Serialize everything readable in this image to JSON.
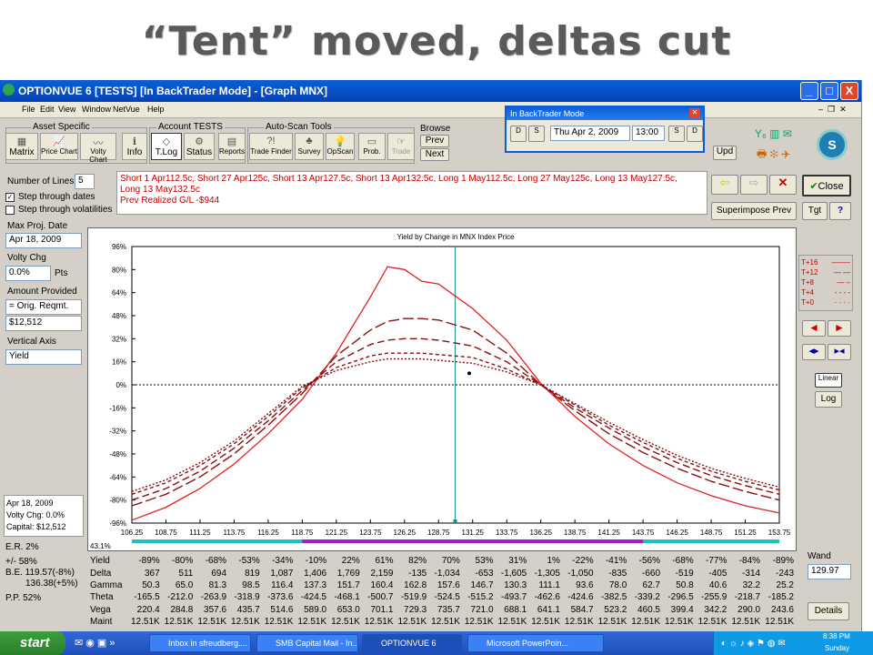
{
  "slide": {
    "title": "“Tent” moved, deltas cut"
  },
  "window": {
    "title": "OPTIONVUE 6   [TESTS]   [In BackTrader Mode] - [Graph MNX]",
    "min": "_",
    "max": "□",
    "close": "X"
  },
  "menu": [
    "File",
    "Edit",
    "View",
    "Window",
    "NetVue",
    "Help"
  ],
  "toolbar": {
    "group_asset": "Asset Specific",
    "group_account": "Account TESTS",
    "group_autoscan": "Auto-Scan Tools",
    "browse": "Browse",
    "matrix": "Matrix",
    "price_chart": "Price Chart",
    "volty_chart": "Volty Chart",
    "info": "Info",
    "tlog": "T.Log",
    "status": "Status",
    "reports": "Reports",
    "trade_finder": "Trade Finder",
    "survey": "Survey",
    "opscan": "OpScan",
    "prob": "Prob.",
    "trade": "Trade",
    "prev": "Prev",
    "next": "Next",
    "upd": "Upd"
  },
  "backtrader": {
    "title": "In BackTrader Mode",
    "date": "Thu Apr 2, 2009",
    "time": "13:00",
    "btn_d_back": "D",
    "btn_s_back": "S",
    "btn_s_fwd": "S",
    "btn_d_fwd": "D"
  },
  "left_panel": {
    "num_lines_label": "Number of Lines",
    "num_lines_value": "5",
    "step_dates": "Step through dates",
    "step_volts": "Step through volatilities",
    "max_proj_label": "Max Proj. Date",
    "max_proj_value": "Apr 18, 2009",
    "volty_chg_label": "Volty Chg",
    "volty_chg_value": "0.0%",
    "volty_unit": "Pts",
    "amount_label": "Amount Provided",
    "amount_select": "= Orig. Reqmt.",
    "amount_value": "$12,512",
    "vert_axis_label": "Vertical Axis",
    "vert_axis_value": "Yield",
    "summary_date": "Apr 18, 2009",
    "summary_volty": "Volty Chg:  0.0%",
    "summary_capital": "Capital:  $12,512",
    "er": "E.R.    2%",
    "pm": "+/-    58%",
    "be1": "B.E.  119.57(-8%)",
    "be2": "136.38(+5%)",
    "pp": "P.P.  52%"
  },
  "strategy": {
    "line1": "Short 1 Apr112.5c, Short 27 Apr125c, Short 13 Apr127.5c, Short 13 Apr132.5c, Long 1 May112.5c, Long 27 May125c, Long 13 May127.5c,",
    "line2": "Long 13 May132.5c",
    "line3": "Prev Realized G/L -$944"
  },
  "right_panel": {
    "close": "Close",
    "superimpose": "Superimpose Prev",
    "tgt": "Tgt",
    "help": "?",
    "linear": "Linear",
    "log": "Log",
    "wand": "Wand",
    "wand_value": "129.97",
    "details": "Details"
  },
  "legend": [
    "T+16",
    "T+12",
    "T+8",
    "T+4",
    "T+0"
  ],
  "chart_data": {
    "type": "line",
    "title": "Yield by Change in MNX Index Price",
    "xlabel": "",
    "ylabel": "",
    "x_ticks": [
      "106.25",
      "108.75",
      "111.25",
      "113.75",
      "116.25",
      "118.75",
      "121.25",
      "123.75",
      "126.25",
      "128.75",
      "131.25",
      "133.75",
      "136.25",
      "138.75",
      "141.25",
      "143.75",
      "146.25",
      "148.75",
      "151.25",
      "153.75"
    ],
    "y_ticks": [
      "96%",
      "80%",
      "64%",
      "48%",
      "32%",
      "16%",
      "0%",
      "-16%",
      "-32%",
      "-48%",
      "-64%",
      "-80%",
      "-96%"
    ],
    "ylim": [
      -96,
      96
    ],
    "xlim": [
      106.25,
      153.75
    ],
    "corner_label": "43.1%",
    "current_price": 129.97,
    "x": [
      106.25,
      108.75,
      111.25,
      113.75,
      116.25,
      118.75,
      121.25,
      123.75,
      125.0,
      126.25,
      127.5,
      128.75,
      131.25,
      133.75,
      136.25,
      138.75,
      141.25,
      143.75,
      146.25,
      148.75,
      151.25,
      153.75
    ],
    "series": [
      {
        "name": "T+16",
        "values": [
          -94,
          -85,
          -72,
          -55,
          -34,
          -10,
          22,
          61,
          82,
          80,
          72,
          70,
          53,
          31,
          1,
          -22,
          -41,
          -56,
          -68,
          -77,
          -84,
          -89
        ]
      },
      {
        "name": "T+12",
        "values": [
          -84,
          -76,
          -64,
          -48,
          -28,
          -6,
          20,
          38,
          44,
          46,
          46,
          45,
          38,
          22,
          0,
          -18,
          -34,
          -47,
          -58,
          -67,
          -74,
          -80
        ]
      },
      {
        "name": "T+8",
        "values": [
          -80,
          -72,
          -60,
          -44,
          -25,
          -4,
          16,
          28,
          31,
          32,
          32,
          31,
          27,
          16,
          0,
          -16,
          -30,
          -43,
          -54,
          -63,
          -70,
          -76
        ]
      },
      {
        "name": "T+4",
        "values": [
          -76,
          -68,
          -56,
          -41,
          -22,
          -2,
          12,
          20,
          22,
          22,
          22,
          21,
          19,
          11,
          0,
          -14,
          -28,
          -40,
          -51,
          -60,
          -67,
          -73
        ]
      },
      {
        "name": "T+0",
        "values": [
          -74,
          -66,
          -54,
          -39,
          -20,
          -1,
          10,
          16,
          18,
          18,
          18,
          17,
          15,
          9,
          0,
          -13,
          -26,
          -38,
          -49,
          -58,
          -65,
          -71
        ]
      }
    ]
  },
  "greeks": {
    "rows": [
      {
        "label": "Yield",
        "values": [
          "-89%",
          "-80%",
          "-68%",
          "-53%",
          "-34%",
          "-10%",
          "22%",
          "61%",
          "82%",
          "70%",
          "53%",
          "31%",
          "1%",
          "-22%",
          "-41%",
          "-56%",
          "-68%",
          "-77%",
          "-84%",
          "-89%"
        ]
      },
      {
        "label": "Delta",
        "values": [
          "367",
          "511",
          "694",
          "819",
          "1,087",
          "1,406",
          "1,769",
          "2,159",
          "-135",
          "-1,034",
          "-653",
          "-1,605",
          "-1,305",
          "-1,050",
          "-835",
          "-660",
          "-519",
          "-405",
          "-314",
          "-243"
        ]
      },
      {
        "label": "Gamma",
        "values": [
          "50.3",
          "65.0",
          "81.3",
          "98.5",
          "116.4",
          "137.3",
          "151.7",
          "160.4",
          "162.8",
          "157.6",
          "146.7",
          "130.3",
          "111.1",
          "93.6",
          "78.0",
          "62.7",
          "50.8",
          "40.6",
          "32.2",
          "25.2"
        ]
      },
      {
        "label": "Theta",
        "values": [
          "-165.5",
          "-212.0",
          "-263.9",
          "-318.9",
          "-373.6",
          "-424.5",
          "-468.1",
          "-500.7",
          "-519.9",
          "-524.5",
          "-515.2",
          "-493.7",
          "-462.6",
          "-424.6",
          "-382.5",
          "-339.2",
          "-296.5",
          "-255.9",
          "-218.7",
          "-185.2"
        ]
      },
      {
        "label": "Vega",
        "values": [
          "220.4",
          "284.8",
          "357.6",
          "435.7",
          "514.6",
          "589.0",
          "653.0",
          "701.1",
          "729.3",
          "735.7",
          "721.0",
          "688.1",
          "641.1",
          "584.7",
          "523.2",
          "460.5",
          "399.4",
          "342.2",
          "290.0",
          "243.6"
        ]
      },
      {
        "label": "Maint",
        "values": [
          "12.51K",
          "12.51K",
          "12.51K",
          "12.51K",
          "12.51K",
          "12.51K",
          "12.51K",
          "12.51K",
          "12.51K",
          "12.51K",
          "12.51K",
          "12.51K",
          "12.51K",
          "12.51K",
          "12.51K",
          "12.51K",
          "12.51K",
          "12.51K",
          "12.51K",
          "12.51K"
        ]
      }
    ]
  },
  "taskbar": {
    "start": "start",
    "tasks": [
      "Inbox in sfreudberg....",
      "SMB Capital Mail - In...",
      "OPTIONVUE 6",
      "Microsoft PowerPoin..."
    ],
    "time": "8:38 PM",
    "day": "Sunday"
  }
}
